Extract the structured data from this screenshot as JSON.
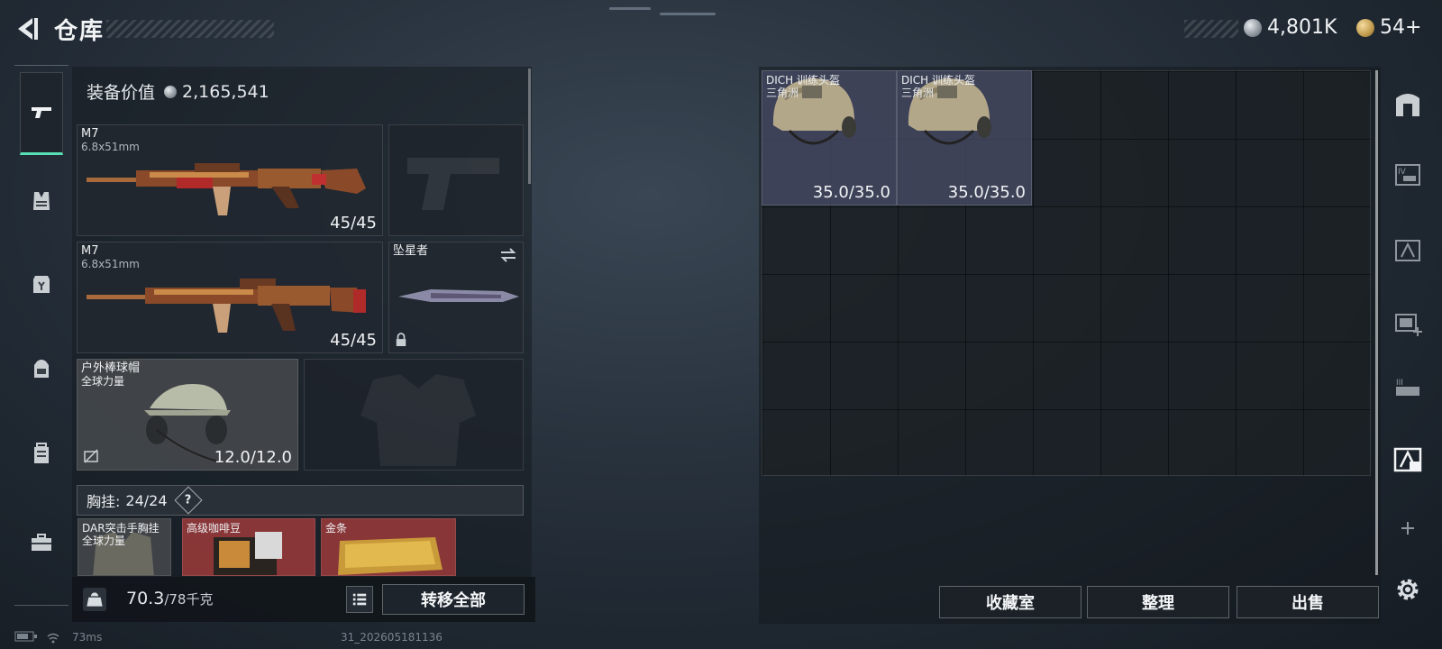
{
  "header": {
    "title": "仓库",
    "currency_silver": "4,801K",
    "currency_gold": "54+"
  },
  "rail": {
    "items": [
      "pistol-icon",
      "vest-icon",
      "armor-icon",
      "backpack-icon",
      "case-icon",
      "toolbox-icon"
    ],
    "active_index": 0
  },
  "equipment": {
    "value_label": "装备价值",
    "value": "2,165,541",
    "primary_1": {
      "name": "M7",
      "caliber": "6.8x51mm",
      "ammo": "45/45"
    },
    "primary_2": {
      "name": "M7",
      "caliber": "6.8x51mm",
      "ammo": "45/45"
    },
    "melee": {
      "name": "坠星者"
    },
    "helmet": {
      "name": "户外棒球帽",
      "sub": "全球力量",
      "durability": "12.0/12.0"
    },
    "chest_rig": {
      "label": "胸挂:",
      "count": "24/24",
      "help": "?"
    },
    "chest_items": [
      {
        "name": "DAR突击手胸挂",
        "sub": "全球力量"
      },
      {
        "name": "高级咖啡豆"
      },
      {
        "name": "金条"
      }
    ],
    "weight": "70.3",
    "weight_max": "/78千克",
    "transfer_all": "转移全部"
  },
  "stash": {
    "items": [
      {
        "name": "DICH 训练头盔",
        "sub": "三角洲",
        "durability": "35.0/35.0"
      },
      {
        "name": "DICH 训练头盔",
        "sub": "三角洲",
        "durability": "35.0/35.0"
      }
    ],
    "buttons": {
      "collection": "收藏室",
      "sort": "整理",
      "sell": "出售"
    }
  },
  "right_rail": {
    "items": [
      "stash-icon",
      "tab-iv-icon",
      "tab-a-icon",
      "tab-add-icon",
      "tab-iii-icon",
      "tab-active-icon",
      "plus-icon",
      "settings-icon"
    ]
  },
  "status": {
    "ping": "73ms",
    "build": "31_202605181136"
  },
  "colors": {
    "accent": "#58e0b6",
    "stash_item_bg": "#4a4e68"
  }
}
